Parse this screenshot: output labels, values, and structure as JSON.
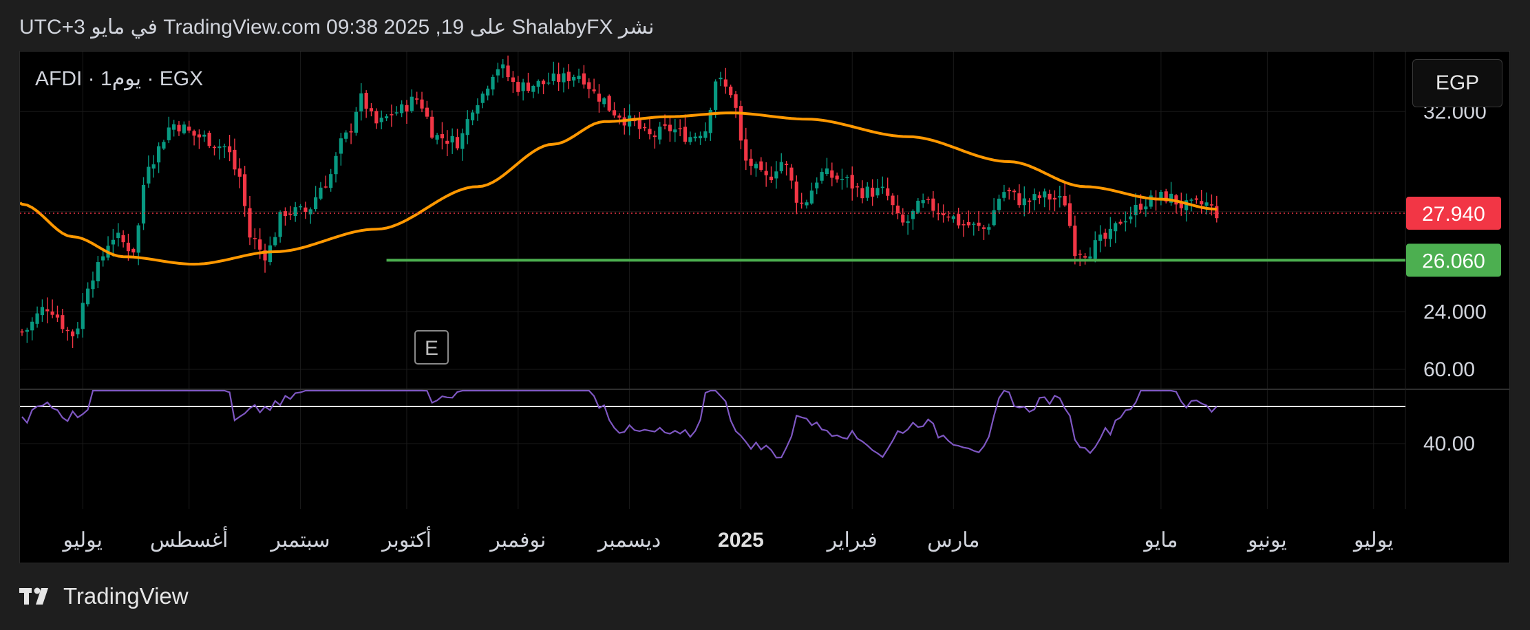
{
  "header": {
    "title": "نشر ShalabyFX على TradingView.com 09:38 2025 ,19 في مايو UTC+3"
  },
  "symbol": {
    "label": "AFDI · 1يوم · EGX"
  },
  "currency_button": {
    "label": "EGP"
  },
  "footer": {
    "brand": "TradingView"
  },
  "event_marker": {
    "label": "E"
  },
  "chart_data": [
    {
      "type": "candlestick",
      "title": "",
      "ylim": [
        20.9,
        34.4
      ],
      "y_ticks": [
        {
          "value": 24.0,
          "label": "24.000"
        },
        {
          "value": 32.0,
          "label": "32.000"
        }
      ],
      "x_ticks": [
        {
          "index": 12,
          "label": "يوليو"
        },
        {
          "index": 33,
          "label": "أغسطس"
        },
        {
          "index": 55,
          "label": "سبتمبر"
        },
        {
          "index": 76,
          "label": "أكتوبر"
        },
        {
          "index": 98,
          "label": "نوفمبر"
        },
        {
          "index": 120,
          "label": "ديسمبر"
        },
        {
          "index": 142,
          "label": "2025",
          "bold": true
        },
        {
          "index": 164,
          "label": "فبراير"
        },
        {
          "index": 184,
          "label": "مارس"
        },
        {
          "index": 225,
          "label": "مايو"
        },
        {
          "index": 246,
          "label": "يونيو"
        },
        {
          "index": 267,
          "label": "يوليو"
        }
      ],
      "last_price": {
        "value": 27.94,
        "label": "27.940",
        "color": "#f23645"
      },
      "horizontal_line": {
        "value": 26.06,
        "label": "26.060",
        "color": "#4caf50",
        "from_index": 72
      },
      "ma_color": "#ff9800",
      "up_color": "#089981",
      "down_color": "#f23645",
      "moving_average_anchors": [
        [
          0,
          28.3
        ],
        [
          10,
          27.0
        ],
        [
          20,
          26.2
        ],
        [
          34,
          25.9
        ],
        [
          50,
          26.4
        ],
        [
          70,
          27.3
        ],
        [
          90,
          29.0
        ],
        [
          105,
          30.7
        ],
        [
          115,
          31.6
        ],
        [
          128,
          31.8
        ],
        [
          140,
          31.95
        ],
        [
          155,
          31.7
        ],
        [
          175,
          31.0
        ],
        [
          195,
          30.0
        ],
        [
          210,
          29.0
        ],
        [
          225,
          28.5
        ],
        [
          236,
          28.1
        ]
      ],
      "price_path": [
        [
          0,
          23.2
        ],
        [
          5,
          24.2
        ],
        [
          10,
          23.1
        ],
        [
          14,
          25.5
        ],
        [
          18,
          27.0
        ],
        [
          22,
          26.5
        ],
        [
          25,
          30.0
        ],
        [
          30,
          31.5
        ],
        [
          35,
          31.0
        ],
        [
          40,
          30.6
        ],
        [
          43,
          29.4
        ],
        [
          45,
          27.0
        ],
        [
          48,
          26.3
        ],
        [
          52,
          28.0
        ],
        [
          56,
          28.0
        ],
        [
          60,
          29.2
        ],
        [
          64,
          31.0
        ],
        [
          67,
          32.5
        ],
        [
          70,
          31.5
        ],
        [
          74,
          32.0
        ],
        [
          78,
          32.5
        ],
        [
          82,
          31.0
        ],
        [
          86,
          30.8
        ],
        [
          90,
          32.5
        ],
        [
          94,
          33.8
        ],
        [
          98,
          33.0
        ],
        [
          102,
          33.1
        ],
        [
          106,
          33.3
        ],
        [
          110,
          33.5
        ],
        [
          114,
          32.6
        ],
        [
          117,
          32.0
        ],
        [
          120,
          31.6
        ],
        [
          124,
          31.0
        ],
        [
          128,
          31.3
        ],
        [
          132,
          31.0
        ],
        [
          135,
          31.3
        ],
        [
          137,
          33.3
        ],
        [
          140,
          32.8
        ],
        [
          143,
          30.0
        ],
        [
          147,
          29.3
        ],
        [
          150,
          30.0
        ],
        [
          154,
          28.3
        ],
        [
          158,
          29.5
        ],
        [
          162,
          29.3
        ],
        [
          166,
          28.8
        ],
        [
          170,
          28.8
        ],
        [
          174,
          27.5
        ],
        [
          178,
          28.3
        ],
        [
          182,
          28.0
        ],
        [
          186,
          27.5
        ],
        [
          190,
          27.3
        ],
        [
          194,
          28.8
        ],
        [
          198,
          28.4
        ],
        [
          202,
          28.6
        ],
        [
          206,
          28.4
        ],
        [
          208,
          26.5
        ],
        [
          210,
          26.4
        ],
        [
          214,
          26.9
        ],
        [
          218,
          27.8
        ],
        [
          222,
          28.4
        ],
        [
          226,
          28.6
        ],
        [
          230,
          28.2
        ],
        [
          234,
          28.3
        ],
        [
          236,
          27.94
        ]
      ],
      "candle_count": 237
    },
    {
      "type": "line",
      "title": "",
      "ylim": [
        31,
        60.5
      ],
      "y_ticks": [
        {
          "value": 40.0,
          "label": "40.00"
        },
        {
          "value": 60.0,
          "label": "60.00"
        }
      ],
      "reference_line": {
        "value": 50.0,
        "color": "#ffffff"
      },
      "line_color": "#7e57c2",
      "rsi_anchors": [
        [
          0,
          46
        ],
        [
          5,
          51
        ],
        [
          8,
          47
        ],
        [
          12,
          48
        ],
        [
          15,
          58
        ],
        [
          18,
          61
        ],
        [
          22,
          59
        ],
        [
          25,
          61
        ],
        [
          30,
          62
        ],
        [
          35,
          58
        ],
        [
          40,
          59
        ],
        [
          42,
          46
        ],
        [
          46,
          49
        ],
        [
          50,
          50
        ],
        [
          54,
          53
        ],
        [
          58,
          57
        ],
        [
          62,
          60
        ],
        [
          66,
          59
        ],
        [
          70,
          58
        ],
        [
          74,
          59
        ],
        [
          78,
          57
        ],
        [
          82,
          51
        ],
        [
          86,
          54
        ],
        [
          90,
          58
        ],
        [
          94,
          61
        ],
        [
          98,
          57
        ],
        [
          102,
          57
        ],
        [
          106,
          57
        ],
        [
          110,
          58
        ],
        [
          114,
          51
        ],
        [
          118,
          44
        ],
        [
          122,
          43
        ],
        [
          126,
          43
        ],
        [
          130,
          42
        ],
        [
          133,
          43
        ],
        [
          136,
          59
        ],
        [
          138,
          54
        ],
        [
          142,
          41
        ],
        [
          146,
          39
        ],
        [
          150,
          37
        ],
        [
          154,
          48
        ],
        [
          158,
          44
        ],
        [
          162,
          43
        ],
        [
          166,
          41
        ],
        [
          170,
          37
        ],
        [
          174,
          44
        ],
        [
          178,
          46
        ],
        [
          182,
          42
        ],
        [
          186,
          40
        ],
        [
          190,
          38
        ],
        [
          194,
          54
        ],
        [
          198,
          49
        ],
        [
          202,
          52
        ],
        [
          206,
          51
        ],
        [
          208,
          42
        ],
        [
          210,
          38
        ],
        [
          214,
          43
        ],
        [
          218,
          49
        ],
        [
          222,
          55
        ],
        [
          226,
          57
        ],
        [
          230,
          51
        ],
        [
          234,
          51
        ],
        [
          236,
          49
        ]
      ]
    }
  ]
}
